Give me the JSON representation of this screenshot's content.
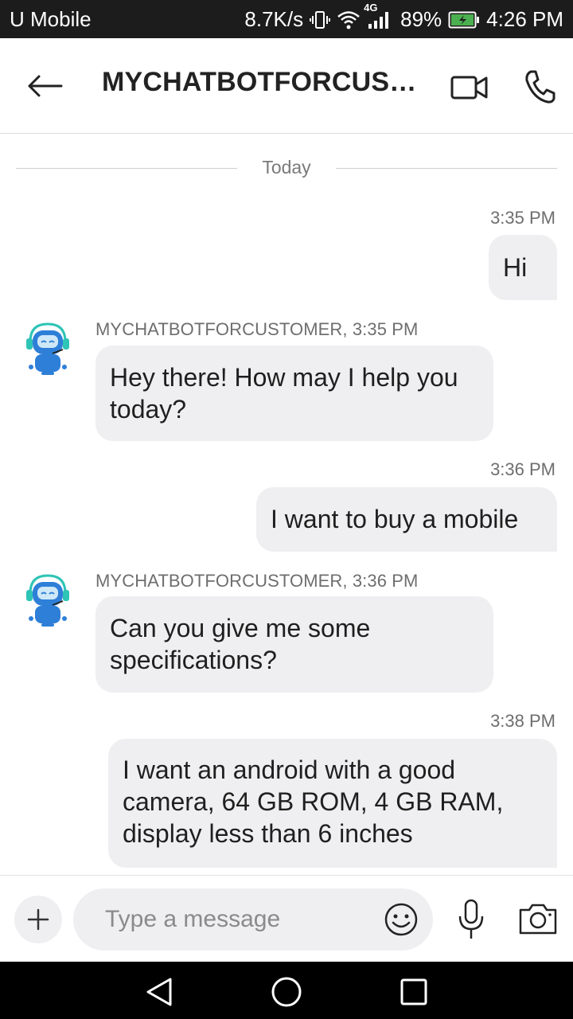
{
  "status_bar": {
    "carrier": "U Mobile",
    "speed": "8.7K/s",
    "network": "4G",
    "battery": "89%",
    "time": "4:26 PM"
  },
  "header": {
    "title": "MYCHATBOTFORCUST..."
  },
  "day_separator": "Today",
  "messages": [
    {
      "direction": "out",
      "time": "3:35 PM",
      "lines": [
        "Hi"
      ]
    },
    {
      "direction": "in",
      "meta": "MYCHATBOTFORCUSTOMER, 3:35 PM",
      "lines": [
        "Hey there! How may I help you",
        "today?"
      ]
    },
    {
      "direction": "out",
      "time": "3:36 PM",
      "lines": [
        "I want to buy a mobile"
      ]
    },
    {
      "direction": "in",
      "meta": "MYCHATBOTFORCUSTOMER, 3:36 PM",
      "lines": [
        "Can you give me some",
        "specifications?"
      ]
    },
    {
      "direction": "out",
      "time": "3:38 PM",
      "lines": [
        "I want an android with a good",
        "camera, 64 GB ROM, 4 GB RAM,",
        "display less than 6 inches"
      ]
    }
  ],
  "composer": {
    "placeholder": "Type a message"
  },
  "colors": {
    "status_bar_bg": "#1c1c1c",
    "bubble_bg": "#efeff1",
    "text": "#1f1f1f",
    "muted": "#6e6e6e",
    "avatar_blue": "#2e7fd8",
    "avatar_teal": "#2ec4b6"
  },
  "icons": {
    "back": "arrow-left-icon",
    "video": "video-camera-icon",
    "call": "phone-icon",
    "plus": "plus-icon",
    "emoji": "smiley-icon",
    "mic": "microphone-icon",
    "camera": "camera-icon",
    "nav_back": "triangle-back-icon",
    "nav_home": "circle-home-icon",
    "nav_recents": "square-recents-icon"
  }
}
